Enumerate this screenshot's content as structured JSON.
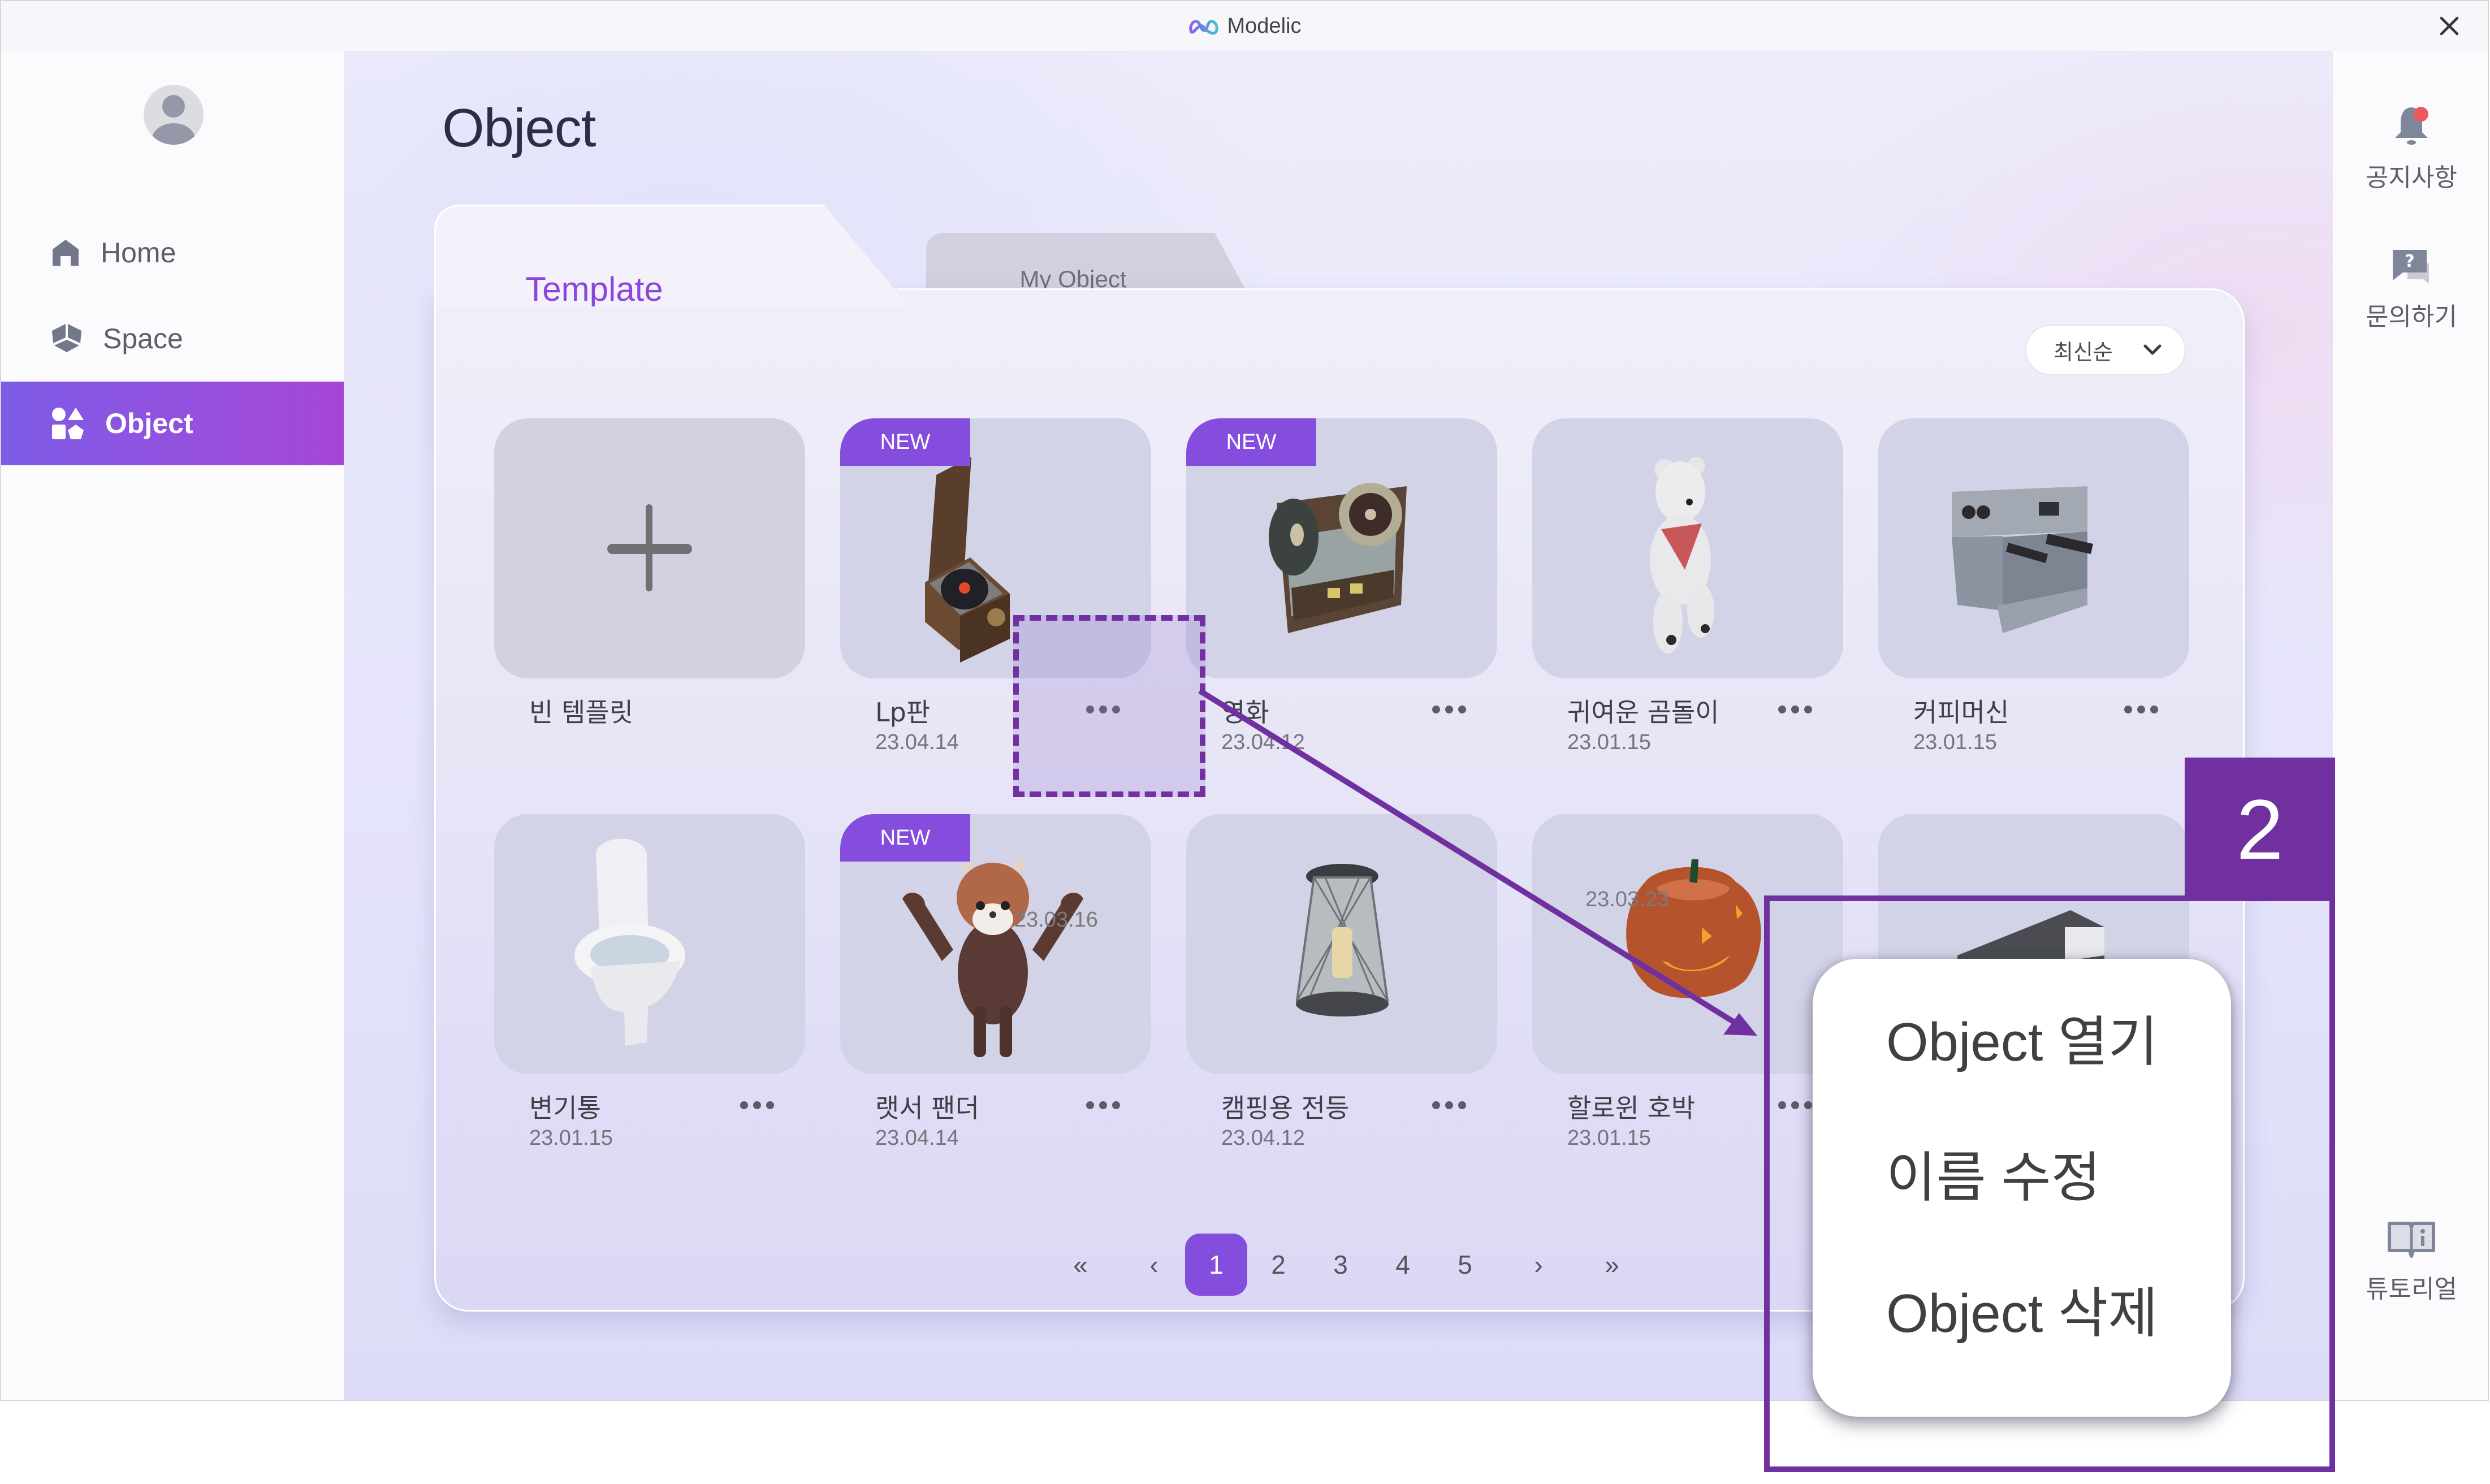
{
  "window": {
    "app_name": "Modelic",
    "close_icon": "close-icon"
  },
  "sidebar": {
    "avatar_icon": "user-avatar-icon",
    "items": [
      {
        "label": "Home",
        "icon": "home-icon",
        "active": false
      },
      {
        "label": "Space",
        "icon": "cube-icon",
        "active": false
      },
      {
        "label": "Object",
        "icon": "shapes-icon",
        "active": true
      }
    ]
  },
  "main": {
    "title": "Object",
    "tabs": [
      {
        "label": "Template",
        "active": true
      },
      {
        "label": "My Object",
        "active": false
      }
    ],
    "sort": {
      "value": "최신순",
      "icon": "chevron-down-icon"
    },
    "badge_label": "NEW",
    "cards": [
      {
        "name": "빈 템플릿",
        "date": "",
        "new": false,
        "thumb": "plus-icon"
      },
      {
        "name": "Lp판",
        "date": "23.04.14",
        "new": true,
        "thumb": "record-player"
      },
      {
        "name": "영화",
        "date": "23.04.12",
        "new": true,
        "thumb": "film-projector"
      },
      {
        "name": "귀여운 곰돌이",
        "date": "23.01.15",
        "new": false,
        "thumb": "teddy-bear"
      },
      {
        "name": "커피머신",
        "date": "23.01.15",
        "new": false,
        "thumb": "coffee-machine"
      },
      {
        "name": "변기통",
        "date": "23.01.15",
        "new": false,
        "thumb": "toilet"
      },
      {
        "name": "랫서 팬더",
        "date": "23.04.14",
        "new": true,
        "thumb": "red-panda",
        "ghost_date": "23.03.16"
      },
      {
        "name": "캠핑용 전등",
        "date": "23.04.12",
        "new": false,
        "thumb": "camping-lantern"
      },
      {
        "name": "할로윈 호박",
        "date": "23.01.15",
        "new": false,
        "thumb": "halloween-pumpkin",
        "ghost_date": "23.03.23"
      },
      {
        "name": "",
        "date": "",
        "new": false,
        "thumb": "dark-box"
      }
    ],
    "pagination": {
      "first": "«",
      "prev": "‹",
      "pages": [
        "1",
        "2",
        "3",
        "4",
        "5"
      ],
      "current": "1",
      "next": "›",
      "last": "»"
    }
  },
  "right_sidebar": {
    "items": [
      {
        "label": "공지사항",
        "icon": "bell-icon",
        "has_notification": true
      },
      {
        "label": "문의하기",
        "icon": "question-chat-icon"
      },
      {
        "label": "튜토리얼",
        "icon": "book-info-icon"
      }
    ]
  },
  "context_menu": {
    "items": [
      "Object 열기",
      "이름 수정",
      "Object 삭제"
    ]
  },
  "annotation": {
    "step_number": "2",
    "color": "#7030a0"
  },
  "colors": {
    "accent": "#854ddd",
    "active_nav_start": "#7c5ce6",
    "active_nav_end": "#a646d6",
    "notification_dot": "#ea5a5c"
  }
}
